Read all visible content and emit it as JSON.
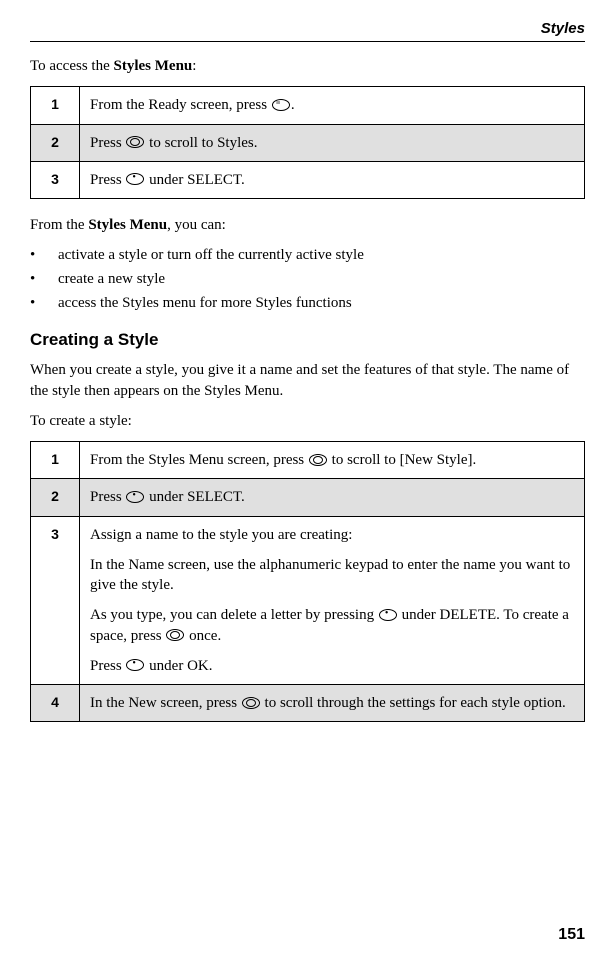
{
  "header": {
    "section": "Styles"
  },
  "intro1_pre": "To access the ",
  "intro1_bold": "Styles Menu",
  "intro1_post": ":",
  "table1": {
    "rows": [
      {
        "num": "1",
        "pre": "From the ",
        "bold": "Ready",
        "mid": " screen, press ",
        "icon": "menu",
        "post": "."
      },
      {
        "num": "2",
        "pre": "Press ",
        "icon": "nav",
        "mid": " to scroll to ",
        "bold": "Styles",
        "post": "."
      },
      {
        "num": "3",
        "pre": "Press ",
        "icon": "soft",
        "post": " under SELECT."
      }
    ]
  },
  "intro2_pre": "From the ",
  "intro2_bold": "Styles Menu",
  "intro2_post": ", you can:",
  "bullets": [
    "activate a style or turn off the currently active style",
    "create a new style"
  ],
  "bullet3_pre": "access the ",
  "bullet3_bold": "Styles",
  "bullet3_post": " menu for more Styles functions",
  "heading": "Creating a Style",
  "create_p1": "When you create a style, you give it a name and set the features of that style. The name of the style then appears on the Styles Menu.",
  "create_p2": "To create a style:",
  "table2": {
    "r1": {
      "num": "1",
      "pre": "From the ",
      "bold1": "Styles Menu",
      "mid1": " screen, press ",
      "icon": "nav",
      "mid2": " to scroll to ",
      "bold2": "[New Style]",
      "post": "."
    },
    "r2": {
      "num": "2",
      "pre": "Press ",
      "icon": "soft",
      "post": " under SELECT."
    },
    "r3": {
      "num": "3",
      "line1": "Assign a name to the style you are creating:",
      "line2_pre": "In the ",
      "line2_bold": "Name",
      "line2_post": " screen, use the alphanumeric keypad to enter the name you want to give the style.",
      "line3_pre": "As you type, you can delete a letter by pressing ",
      "line3_icon1": "soft",
      "line3_mid": " under DELETE. To create a space, press ",
      "line3_icon2": "nav",
      "line3_post": " once.",
      "line4_pre": "Press ",
      "line4_icon": "soft",
      "line4_post": " under OK."
    },
    "r4": {
      "num": "4",
      "pre": "In the ",
      "bold": "New",
      "mid": " screen, press ",
      "icon": "nav",
      "post": " to scroll through the settings for each style option."
    }
  },
  "pageNumber": "151"
}
